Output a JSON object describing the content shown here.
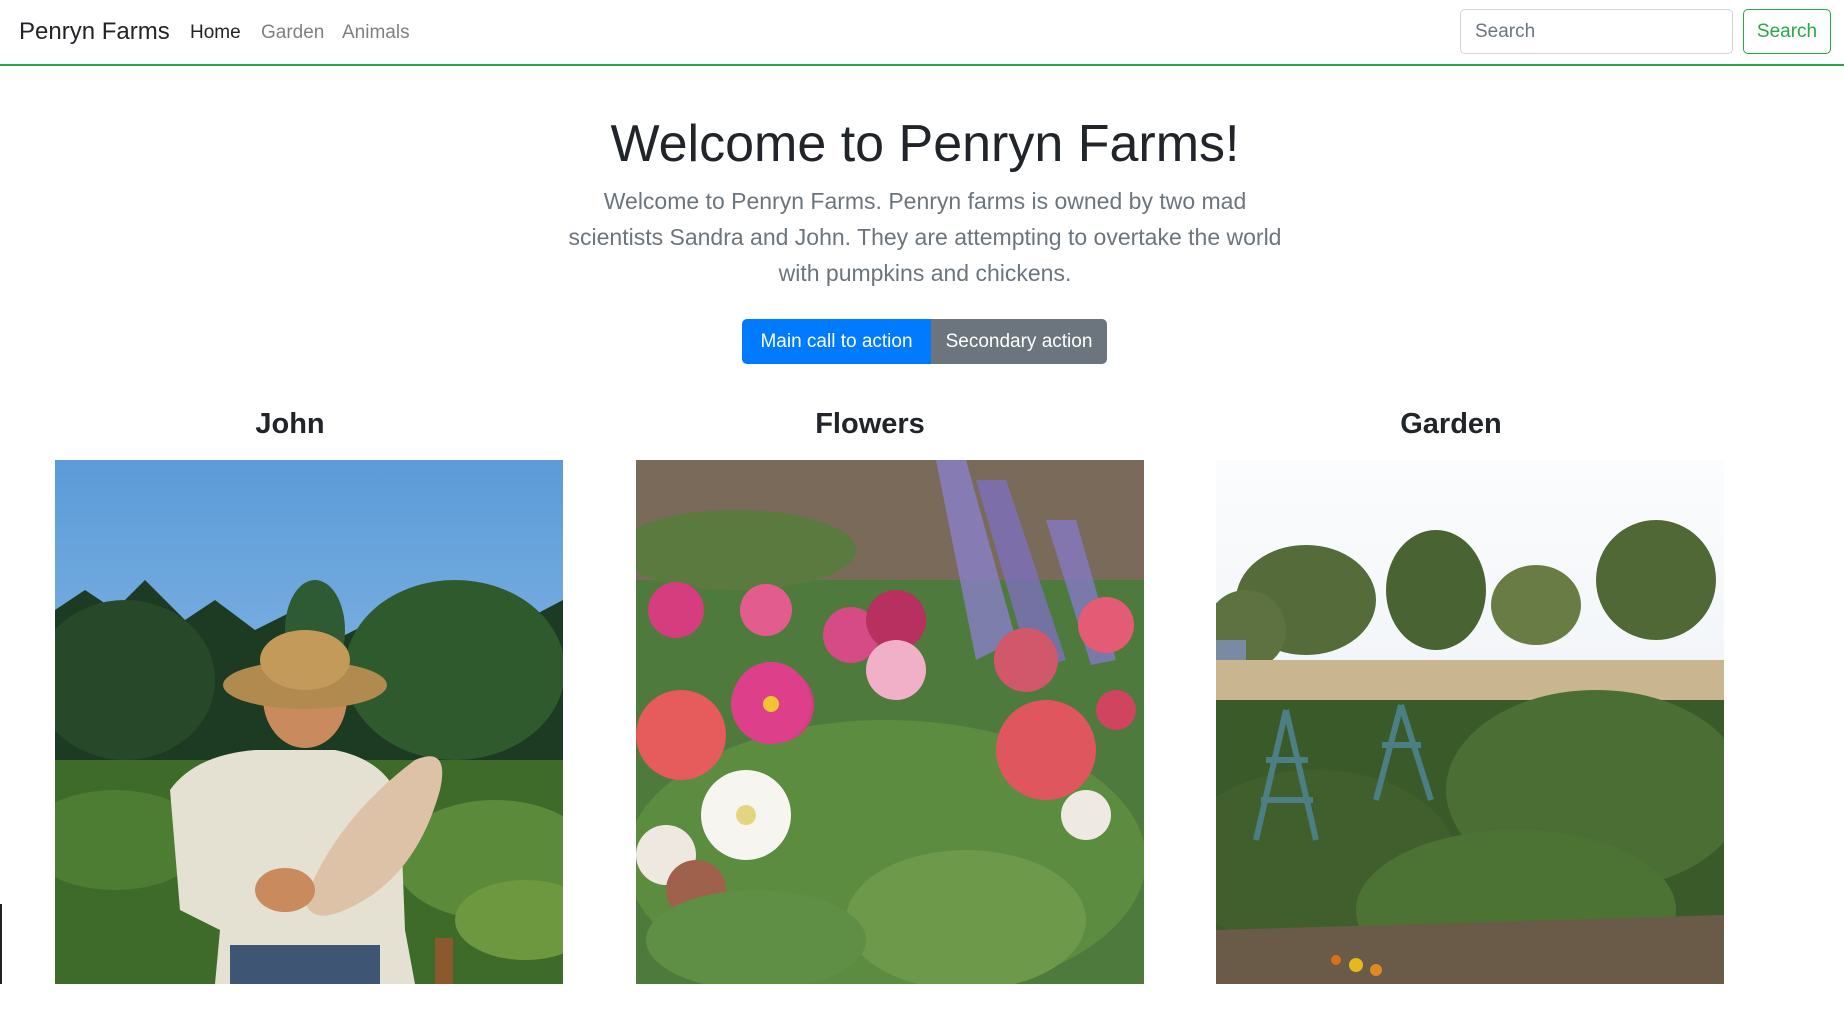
{
  "navbar": {
    "brand": "Penryn Farms",
    "links": [
      {
        "label": "Home",
        "active": true
      },
      {
        "label": "Garden",
        "active": false
      },
      {
        "label": "Animals",
        "active": false
      }
    ],
    "search": {
      "placeholder": "Search",
      "value": "",
      "button_label": "Search"
    },
    "accent_color": "#28a745"
  },
  "hero": {
    "title": "Welcome to Penryn Farms!",
    "lead": "Welcome to Penryn Farms. Penryn farms is owned by two mad scientists Sandra and John. They are attempting to overtake the world with pumpkins and chickens.",
    "primary_button": "Main call to action",
    "secondary_button": "Secondary action",
    "primary_color": "#007bff",
    "secondary_color": "#6c757d"
  },
  "cards": [
    {
      "title": "John",
      "image": "farmer-holding-squash-photo"
    },
    {
      "title": "Flowers",
      "image": "zinnia-flowers-photo"
    },
    {
      "title": "Garden",
      "image": "vegetable-garden-photo"
    }
  ]
}
